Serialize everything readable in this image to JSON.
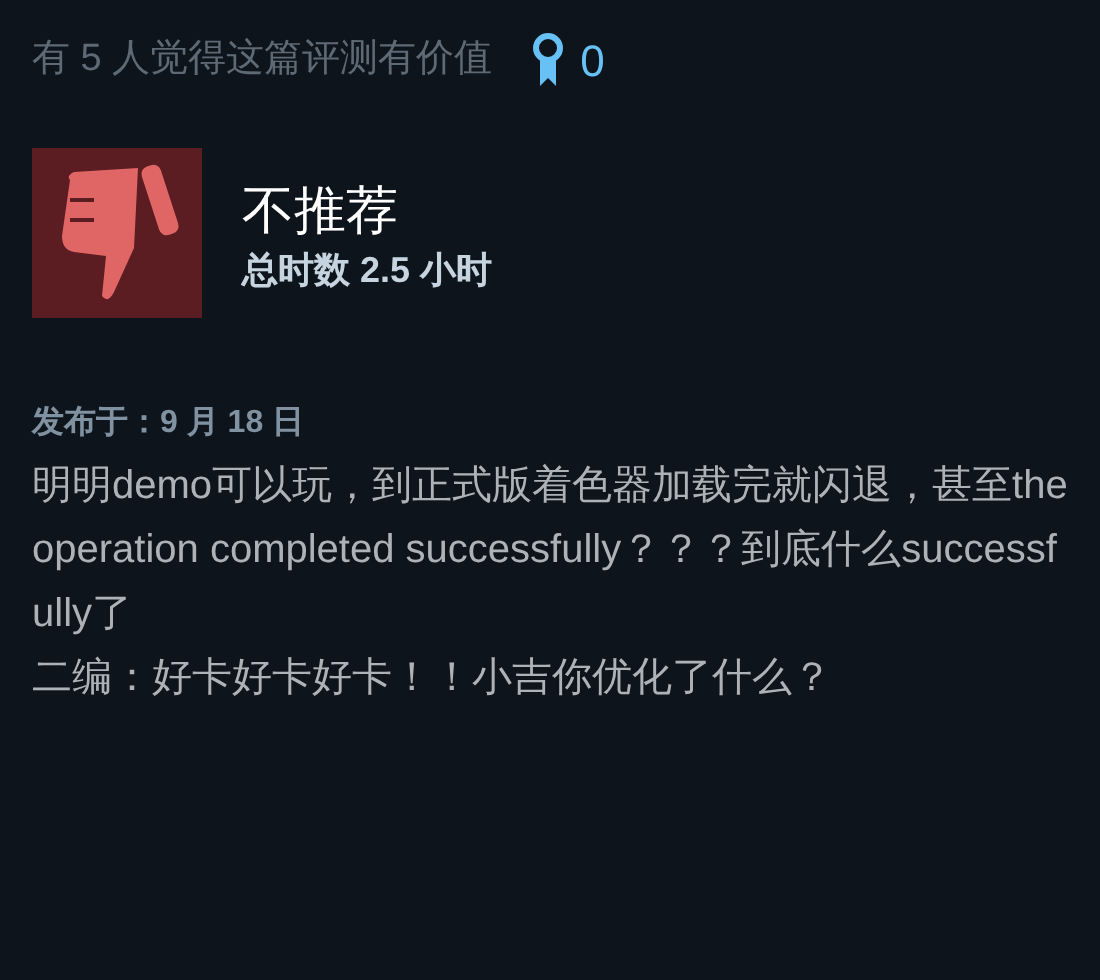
{
  "helpful_text": "有 5 人觉得这篇评测有价值",
  "award_count": "0",
  "review": {
    "recommended": false,
    "verdict": "不推荐",
    "playtime": "总时数 2.5 小时"
  },
  "posted": "发布于：9 月 18 日",
  "paragraphs": [
    "明明demo可以玩，到正式版着色器加载完就闪退，甚至the operation completed successfully？？？到底什么successfully了",
    "二编：好卡好卡好卡！！小吉你优化了什么？"
  ]
}
